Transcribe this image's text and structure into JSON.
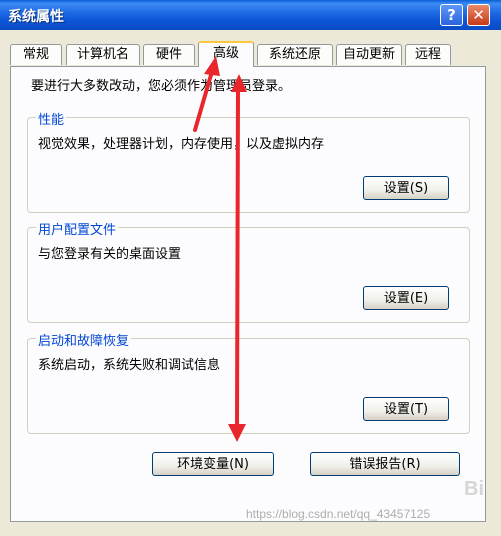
{
  "window": {
    "title": "系统属性",
    "help_symbol": "?",
    "close_symbol": "✕"
  },
  "tabs": [
    {
      "label": "常规"
    },
    {
      "label": "计算机名"
    },
    {
      "label": "硬件"
    },
    {
      "label": "高级",
      "active": true
    },
    {
      "label": "系统还原"
    },
    {
      "label": "自动更新"
    },
    {
      "label": "远程"
    }
  ],
  "panel": {
    "intro": "要进行大多数改动，您必须作为管理员登录。",
    "groups": [
      {
        "title": "性能",
        "description": "视觉效果，处理器计划，内存使用，以及虚拟内存",
        "button": "设置(S)"
      },
      {
        "title": "用户配置文件",
        "description": "与您登录有关的桌面设置",
        "button": "设置(E)"
      },
      {
        "title": "启动和故障恢复",
        "description": "系统启动，系统失败和调试信息",
        "button": "设置(T)"
      }
    ],
    "env_button": "环境变量(N)",
    "error_button": "错误报告(R)"
  },
  "annotation": {
    "arrow_color": "#e8262b"
  },
  "watermark": {
    "text": "https://blog.csdn.net/qq_43457125",
    "logo": "Bi"
  }
}
